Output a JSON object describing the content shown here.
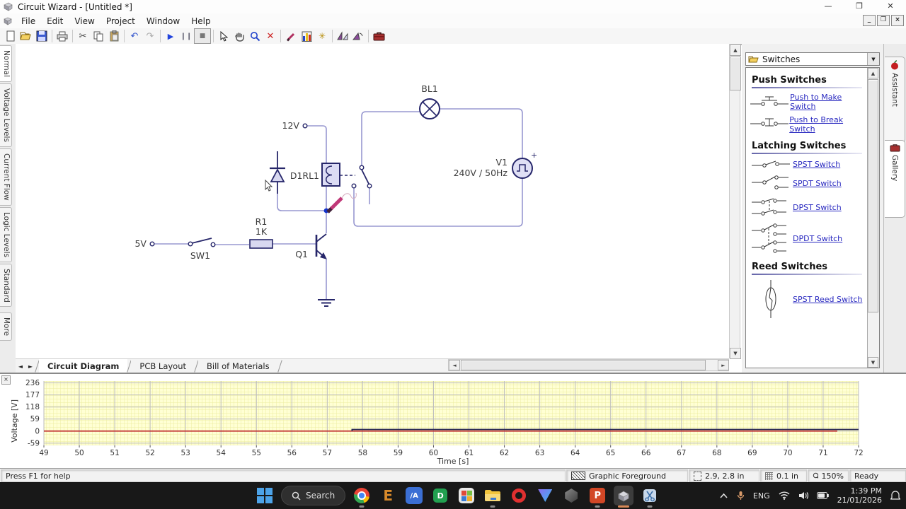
{
  "window": {
    "title": "Circuit Wizard - [Untitled *]",
    "controls": [
      "minimize",
      "restore",
      "close"
    ]
  },
  "menu": {
    "items": [
      "File",
      "Edit",
      "View",
      "Project",
      "Window",
      "Help"
    ]
  },
  "toolbar": {
    "icons": [
      "new",
      "open",
      "save",
      "print",
      "cut",
      "copy",
      "paste",
      "undo",
      "redo",
      "play",
      "pause",
      "stop",
      "select",
      "pan",
      "zoom",
      "delete",
      "probe",
      "graphs",
      "analysis",
      "mirror",
      "rotate",
      "toolbox"
    ]
  },
  "left_tabs": {
    "items": [
      "Normal",
      "Voltage Levels",
      "Current Flow",
      "Logic Levels",
      "Standard",
      "More"
    ]
  },
  "circuit": {
    "labels": {
      "supply12": "12V",
      "diode_relay": "D1RL1",
      "lamp": "BL1",
      "source_name": "V1",
      "source_value": "240V / 50Hz",
      "source_plus": "+",
      "supply5": "5V",
      "switch": "SW1",
      "resistor_name": "R1",
      "resistor_value": "1K",
      "transistor": "Q1"
    }
  },
  "doc_tabs": {
    "items": [
      "Circuit Diagram",
      "PCB Layout",
      "Bill of Materials"
    ],
    "active": "Circuit Diagram"
  },
  "gallery": {
    "dropdown": "Switches",
    "sections": [
      {
        "title": "Push Switches",
        "items": [
          {
            "label": "Push to Make Switch"
          },
          {
            "label": "Push to Break Switch"
          }
        ]
      },
      {
        "title": "Latching Switches",
        "items": [
          {
            "label": "SPST Switch"
          },
          {
            "label": "SPDT Switch"
          },
          {
            "label": "DPST Switch"
          },
          {
            "label": "DPDT Switch"
          }
        ]
      },
      {
        "title": "Reed Switches",
        "items": [
          {
            "label": "SPST Reed Switch"
          }
        ]
      }
    ]
  },
  "side_tabs": {
    "items": [
      "Assistant",
      "Gallery"
    ]
  },
  "chart_data": {
    "type": "line",
    "title": "",
    "xlabel": "Time [s]",
    "ylabel": "Voltage [V]",
    "xlim": [
      49,
      72
    ],
    "ylim": [
      -70,
      245
    ],
    "xticks": [
      49,
      50,
      51,
      52,
      53,
      54,
      55,
      56,
      57,
      58,
      59,
      60,
      61,
      62,
      63,
      64,
      65,
      66,
      67,
      68,
      69,
      70,
      71,
      72
    ],
    "yticks": [
      236,
      177,
      118,
      59,
      0,
      -59
    ],
    "grid": "fine yellow minor grid, gray major grid",
    "legend": "none",
    "series": [
      {
        "name": "voltage-trace-red",
        "color": "#c03030",
        "points": [
          [
            49,
            0
          ],
          [
            71.4,
            0
          ]
        ]
      },
      {
        "name": "voltage-trace-dark",
        "color": "#2a2a52",
        "points": [
          [
            57.7,
            0
          ],
          [
            57.7,
            8
          ],
          [
            72,
            8
          ]
        ]
      }
    ]
  },
  "status_bar": {
    "help": "Press F1 for help",
    "layer": "Graphic Foreground",
    "position": "2.9, 2.8 in",
    "grid": "0.1 in",
    "zoom": "150%",
    "state": "Ready"
  },
  "taskbar": {
    "search": "Search",
    "language": "ENG",
    "time": "1:39 PM",
    "date": "21/01/2026",
    "apps": [
      "start",
      "search",
      "chrome",
      "e-app",
      "a-app",
      "d-app",
      "store",
      "file-explorer",
      "opera",
      "triangle-app",
      "shield-app",
      "powerpoint",
      "circuit-wizard",
      "snipping-tool"
    ],
    "tray": [
      "hidden-icons",
      "microphone",
      "language",
      "wifi",
      "volume",
      "battery",
      "clock",
      "notifications"
    ]
  }
}
